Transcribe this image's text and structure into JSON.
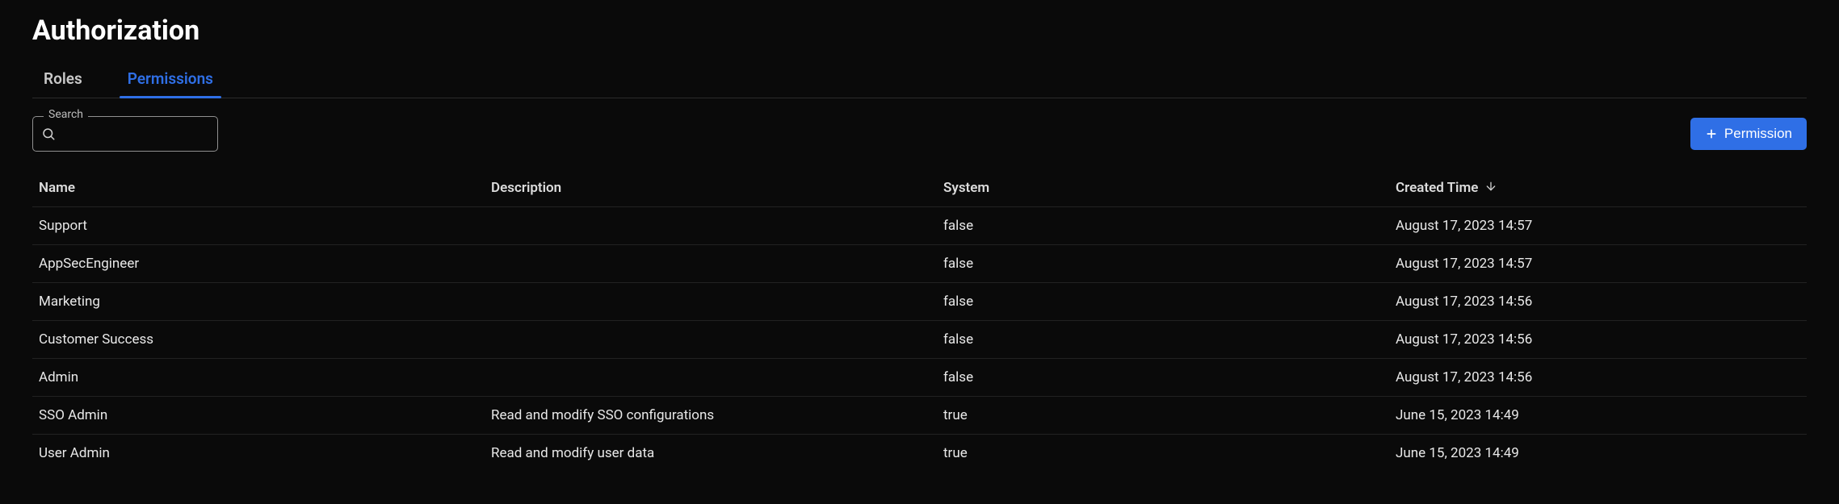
{
  "page": {
    "title": "Authorization"
  },
  "tabs": [
    {
      "label": "Roles",
      "active": false
    },
    {
      "label": "Permissions",
      "active": true
    }
  ],
  "search": {
    "label": "Search",
    "value": "",
    "placeholder": ""
  },
  "toolbar": {
    "permission_button": "Permission"
  },
  "table": {
    "columns": {
      "name": "Name",
      "description": "Description",
      "system": "System",
      "created_time": "Created Time"
    },
    "sort": {
      "column": "created_time",
      "direction": "desc"
    },
    "rows": [
      {
        "name": "Support",
        "description": "",
        "system": "false",
        "created_time": "August 17, 2023 14:57",
        "has_actions": true
      },
      {
        "name": "AppSecEngineer",
        "description": "",
        "system": "false",
        "created_time": "August 17, 2023 14:57",
        "has_actions": true
      },
      {
        "name": "Marketing",
        "description": "",
        "system": "false",
        "created_time": "August 17, 2023 14:56",
        "has_actions": true
      },
      {
        "name": "Customer Success",
        "description": "",
        "system": "false",
        "created_time": "August 17, 2023 14:56",
        "has_actions": true
      },
      {
        "name": "Admin",
        "description": "",
        "system": "false",
        "created_time": "August 17, 2023 14:56",
        "has_actions": true
      },
      {
        "name": "SSO Admin",
        "description": "Read and modify SSO configurations",
        "system": "true",
        "created_time": "June 15, 2023 14:49",
        "has_actions": false
      },
      {
        "name": "User Admin",
        "description": "Read and modify user data",
        "system": "true",
        "created_time": "June 15, 2023 14:49",
        "has_actions": false
      }
    ]
  },
  "icons": {
    "search": "search-icon",
    "plus": "plus-icon",
    "sort_desc": "arrow-down-icon",
    "kebab": "more-vertical-icon"
  },
  "colors": {
    "accent": "#2f6fe6",
    "background": "#0a0a0a"
  }
}
